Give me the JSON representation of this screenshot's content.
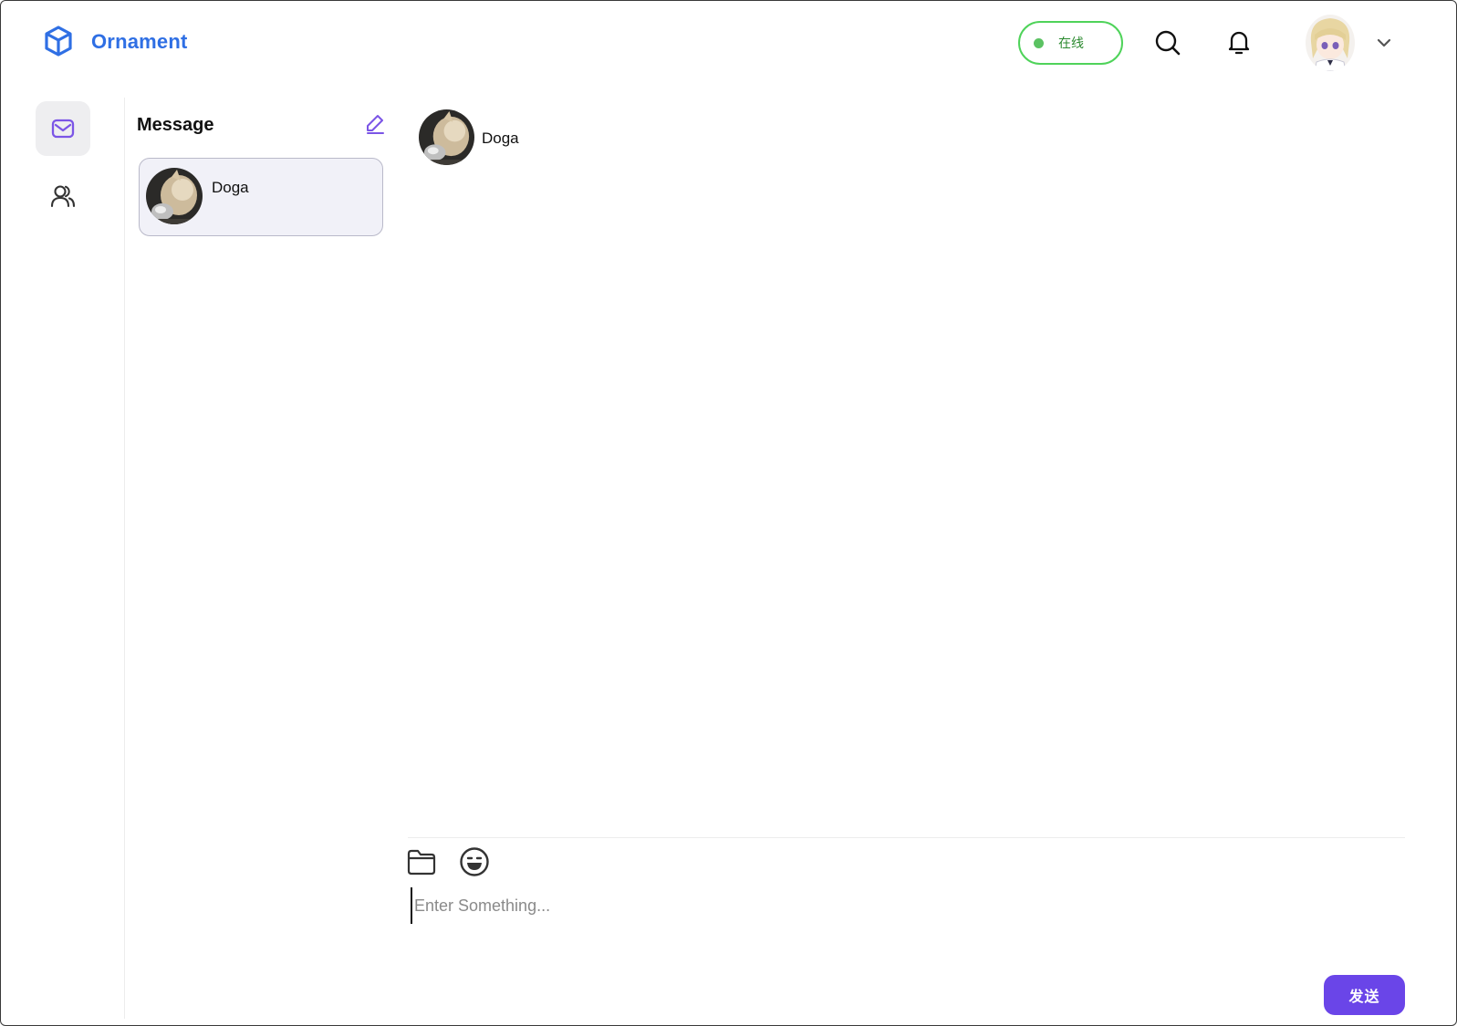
{
  "app": {
    "brand": "Ornament",
    "accent_color": "#2f6fe4",
    "primary_button_color": "#6a45e8",
    "online_color": "#4fd35a"
  },
  "header": {
    "status_label": "在线",
    "icons": [
      "cube-logo-icon",
      "search-icon",
      "bell-icon",
      "chevron-down-icon"
    ]
  },
  "nav": {
    "items": [
      {
        "name": "messages",
        "icon": "mail-icon",
        "active": true
      },
      {
        "name": "contacts",
        "icon": "users-icon",
        "active": false
      }
    ]
  },
  "conversations": {
    "title": "Message",
    "items": [
      {
        "name": "Doga",
        "selected": true
      }
    ]
  },
  "chat": {
    "contact_name": "Doga",
    "input_placeholder": "Enter Something...",
    "send_label": "发送"
  }
}
